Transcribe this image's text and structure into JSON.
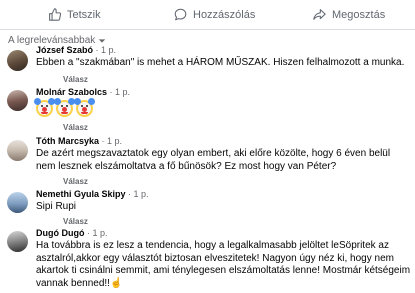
{
  "actions": {
    "like": "Tetszik",
    "comment": "Hozzászólás",
    "share": "Megosztás"
  },
  "sort_label": "A legrelevánsabbak",
  "reply_label": "Válasz",
  "comments": [
    {
      "author": "József Szabó",
      "time": "1 p.",
      "text": "Ebben a \"szakmában\" is mehet a HÁROM MŰSZAK. Hiszen felhalmozott a munka."
    },
    {
      "author": "Molnár Szabolcs",
      "time": "1 p.",
      "emoji": "clown-face-icon",
      "emoji_count": 3
    },
    {
      "author": "Tóth Marcsyka",
      "time": "1 p.",
      "text": "De azért megszavaztatok egy olyan embert, aki előre közölte, hogy 6 éven belül nem lesznek elszámoltatva a fő bűnösök? Ez most hogy van Péter?"
    },
    {
      "author": "Nemethi Gyula Skipy",
      "time": "1 p.",
      "text": "Sipi Rupi"
    },
    {
      "author": "Dugó Dugó",
      "time": "1 p.",
      "text": "Ha továbbra is ez lesz a tendencia, hogy a legalkalmasabb jelöltet leSöpritek az asztalról,akkor egy választót biztosan elveszitetek! Nagyon úgy néz ki, hogy nem akartok ti csinálni semmit, ami ténylegesen elszámoltatás lenne! Mostmár kétségeim vannak benned!!☝️"
    }
  ],
  "colors": {
    "text": "#050505",
    "secondary": "#65676b",
    "divider": "#dadde1",
    "clown": "#fbd148"
  }
}
